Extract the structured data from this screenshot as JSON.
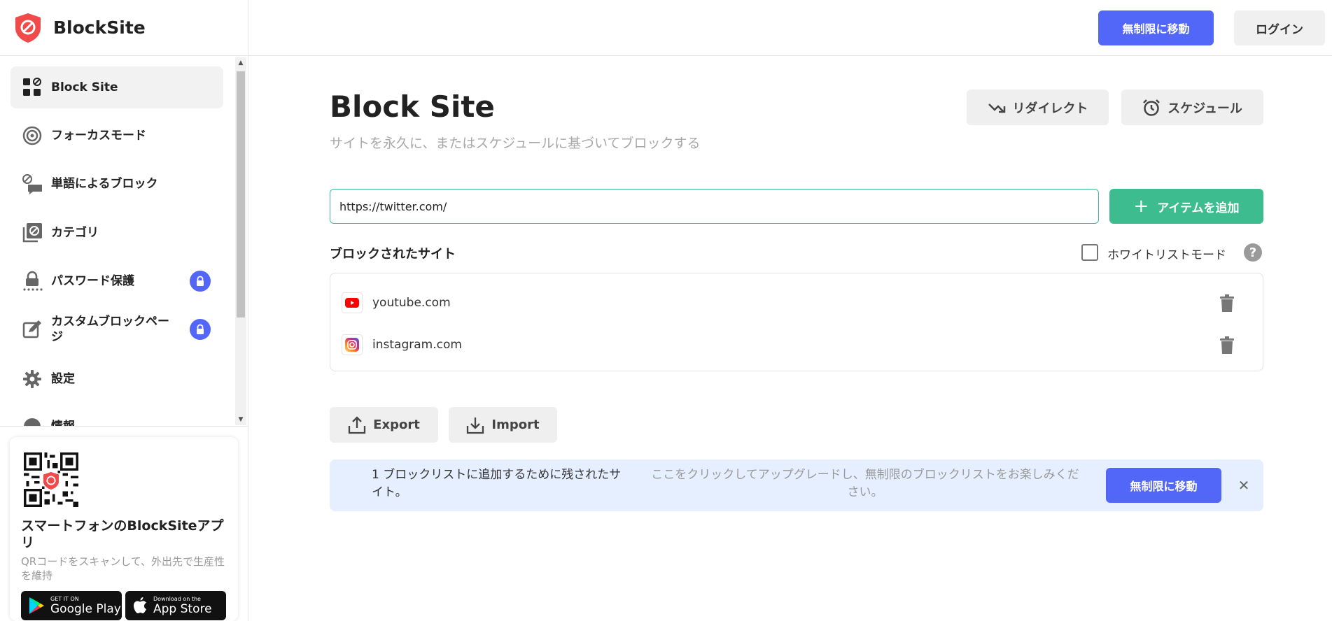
{
  "app": {
    "name": "BlockSite"
  },
  "topbar": {
    "unlimited_label": "無制限に移動",
    "login_label": "ログイン"
  },
  "sidebar": {
    "items": [
      {
        "label": "Block Site",
        "icon": "blocksite-grid-icon",
        "active": true
      },
      {
        "label": "フォーカスモード",
        "icon": "target-icon"
      },
      {
        "label": "単語によるブロック",
        "icon": "word-block-icon"
      },
      {
        "label": "カテゴリ",
        "icon": "category-icon"
      },
      {
        "label": "パスワード保護",
        "icon": "password-lock-icon",
        "locked": true
      },
      {
        "label": "カスタムブロックページ",
        "icon": "custom-page-icon",
        "locked": true
      },
      {
        "label": "設定",
        "icon": "gear-icon"
      },
      {
        "label": "情報",
        "icon": "info-icon"
      }
    ],
    "promo": {
      "title": "スマートフォンのBlockSiteアプリ",
      "subtitle": "QRコードをスキャンして、外出先で生産性を維持",
      "google_play_small": "GET IT ON",
      "google_play_big": "Google Play",
      "app_store_small": "Download on the",
      "app_store_big": "App Store"
    }
  },
  "main": {
    "title": "Block Site",
    "subtitle": "サイトを永久に、またはスケジュールに基づいてブロックする",
    "redirect_label": "リダイレクト",
    "schedule_label": "スケジュール",
    "url_value": "https://twitter.com/",
    "add_label": "アイテムを追加",
    "blocked_title": "ブロックされたサイト",
    "whitelist_label": "ホワイトリストモード",
    "help_glyph": "?",
    "sites": [
      {
        "name": "youtube.com",
        "icon": "youtube-icon"
      },
      {
        "name": "instagram.com",
        "icon": "instagram-icon"
      }
    ],
    "export_label": "Export",
    "import_label": "Import",
    "banner": {
      "remaining": "1 ブロックリストに追加するために残されたサイト。",
      "upgrade_text": "ここをクリックしてアップグレードし、無制限のブロックリストをお楽しみください。",
      "button_label": "無制限に移動",
      "close_glyph": "✕"
    }
  },
  "colors": {
    "accent": "#5266f7",
    "green": "#3dbd8f",
    "banner_bg": "#e5efff",
    "brand_red": "#f04a4a"
  }
}
